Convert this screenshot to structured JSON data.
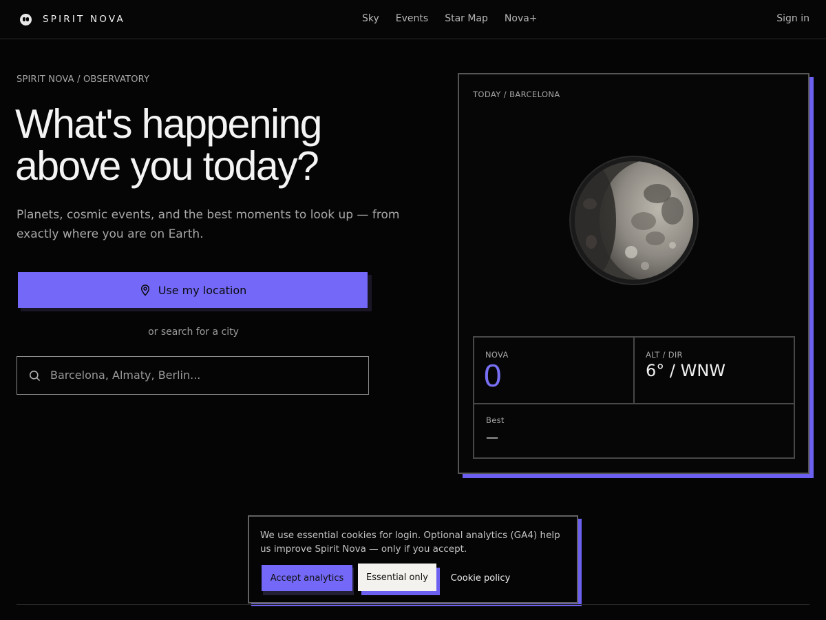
{
  "header": {
    "brand": "SPIRIT NOVA",
    "brand_icon": "alien-face-icon",
    "nav": [
      {
        "label": "Sky"
      },
      {
        "label": "Events"
      },
      {
        "label": "Star Map"
      },
      {
        "label": "Nova+"
      }
    ],
    "signin": "Sign in"
  },
  "hero": {
    "breadcrumb": "SPIRIT NOVA / OBSERVATORY",
    "title_line1": "What's happening",
    "title_line2": "above you today?",
    "subtitle": "Planets, cosmic events, and the best moments to look up — from exactly where you are on Earth.",
    "cta_label": "Use my location",
    "cta_icon": "map-pin-icon",
    "or_search": "or search for a city",
    "search_placeholder": "Barcelona, Almaty, Berlin...",
    "search_icon": "search-icon"
  },
  "moon_card": {
    "label": "TODAY / BARCELONA",
    "stats": {
      "nova_label": "NOVA",
      "nova_value": "0",
      "alt_label": "ALT / DIR",
      "alt_value": "6° / WNW",
      "best_label": "Best",
      "best_value": "—"
    }
  },
  "cookie": {
    "text": "We use essential cookies for login. Optional analytics (GA4) help us improve Spirit Nova — only if you accept.",
    "accept": "Accept analytics",
    "essential": "Essential only",
    "policy": "Cookie policy"
  },
  "colors": {
    "accent": "#7368f7",
    "background": "#050505",
    "text": "#f4f4f4",
    "muted": "#a8a8a8"
  }
}
